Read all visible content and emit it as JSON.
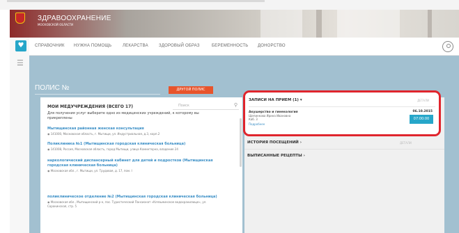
{
  "app": {
    "title": "ЗДРАВООХРАНЕНИЕ",
    "subtitle": "МОСКОВСКОЙ ОБЛАСТИ"
  },
  "nav": {
    "items": [
      "СПРАВОЧНИК",
      "НУЖНА ПОМОЩЬ",
      "ЛЕКАРСТВА",
      "ЗДОРОВЫЙ ОБРАЗ",
      "БЕРЕМЕННОСТЬ",
      "ДОНОРСТВО"
    ]
  },
  "polis": {
    "label": "ПОЛИС №",
    "button_label": "ДРУГОЙ ПОЛИС"
  },
  "clinics": {
    "title": "МОИ МЕДУЧРЕЖДЕНИЯ (ВСЕГО 17)",
    "search_placeholder": "Поиск",
    "description": "Для получения услуг выберите одно из медицинских учреждений, к которому вы прикреплены",
    "items": [
      {
        "name": "Мытищинская районная женская консультация",
        "address": "141000, Московская область, г. Мытищи, ул. Индустриальная, д.3, корп.2"
      },
      {
        "name": "Поликлиника №1 (Мытищинская городская клиническая больница)",
        "address": "141008, Россия, Московская область, город Мытищи, улица Коминтерна, владение 24"
      },
      {
        "name": "наркологический диспансерный кабинет для детей и подростков (Мытищинская городская клиническая больница)",
        "address": "Московская обл., г. Мытищи, ул. Трудовая, д. 17, пом. I"
      },
      {
        "name": "поликлиническое отделение №2 (Мытищинская городская клиническая больница)",
        "address": "Московская обл., Мытищинский р-н, пос. Туристический Пансионат «Клязьминское водохранилище», ул. Сорокинская, стр. 5"
      }
    ]
  },
  "appointments": {
    "title": "ЗАПИСИ НА ПРИЕМ (1)",
    "hint": "ДЕТАЛИ",
    "item": {
      "specialty": "Акушерство и гинекология",
      "doctor": "Щепинкова Ирина Ивановна",
      "cabinet": "Каб. 3",
      "more": "Подробнее",
      "date": "06.10.2015",
      "time": "07:00:00"
    }
  },
  "history": {
    "title": "ИСТОРИЯ ПОСЕЩЕНИЙ",
    "hint": "ДЕТАЛИ"
  },
  "prescriptions": {
    "title": "ВЫПИСАННЫЕ РЕЦЕПТЫ"
  },
  "icons": {
    "brand": "heart-icon",
    "menu": "hamburger-icon",
    "user": "user-icon",
    "search": "search-icon",
    "location": "pin-icon"
  },
  "colors": {
    "accent": "#26a6c9",
    "link": "#3b8fc6",
    "button": "#e8542b",
    "highlight": "#e0252d",
    "workspace": "#a2c0d0"
  }
}
